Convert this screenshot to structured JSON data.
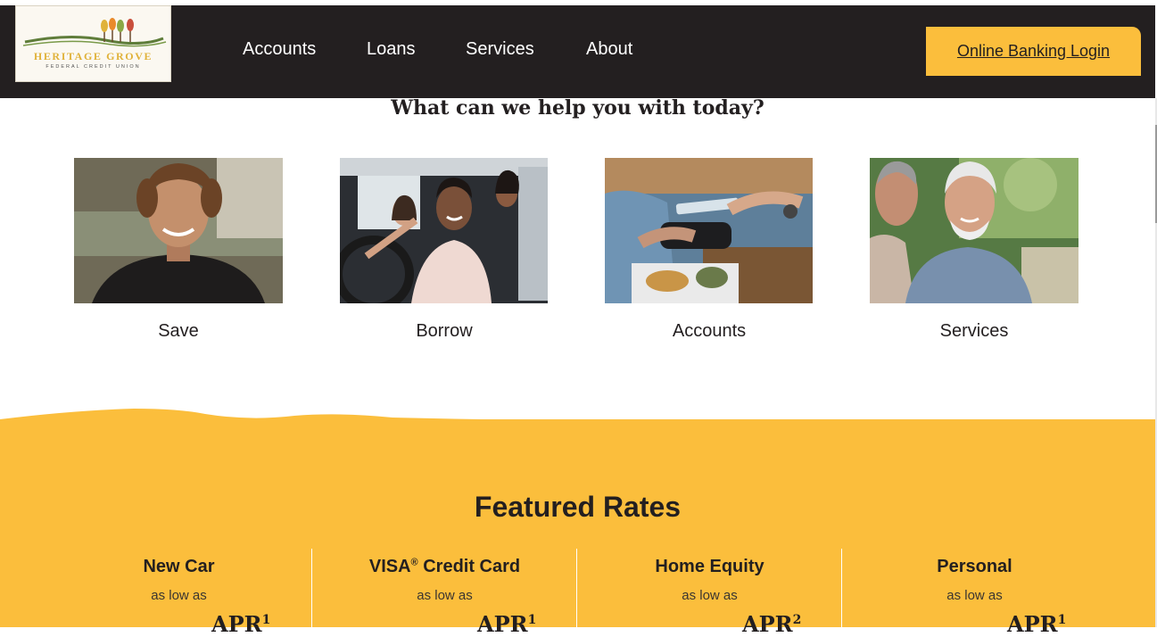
{
  "header": {
    "logo": {
      "brand": "HERITAGE GROVE",
      "tagline": "FEDERAL CREDIT UNION"
    },
    "nav": [
      {
        "label": "Accounts"
      },
      {
        "label": "Loans"
      },
      {
        "label": "Services"
      },
      {
        "label": "About"
      }
    ],
    "login_label": "Online Banking Login"
  },
  "help": {
    "title": "What can we help you with today?",
    "cards": [
      {
        "label": "Save",
        "image": "smiling-young-man-photo"
      },
      {
        "label": "Borrow",
        "image": "friends-in-car-photo"
      },
      {
        "label": "Accounts",
        "image": "contactless-payment-photo"
      },
      {
        "label": "Services",
        "image": "two-older-men-talking-photo"
      }
    ]
  },
  "rates": {
    "title": "Featured Rates",
    "items": [
      {
        "name": "New Car",
        "sub": "as low as",
        "apr": "APR",
        "footnote": "1"
      },
      {
        "name": "VISA",
        "registered": "®",
        "name_suffix": " Credit Card",
        "sub": "as low as",
        "apr": "APR",
        "footnote": "1"
      },
      {
        "name": "Home Equity",
        "sub": "as low as",
        "apr": "APR",
        "footnote": "2"
      },
      {
        "name": "Personal",
        "sub": "as low as",
        "apr": "APR",
        "footnote": "1"
      }
    ]
  },
  "colors": {
    "header_bg": "#231f20",
    "accent": "#fbbe3c",
    "text": "#231f20"
  }
}
